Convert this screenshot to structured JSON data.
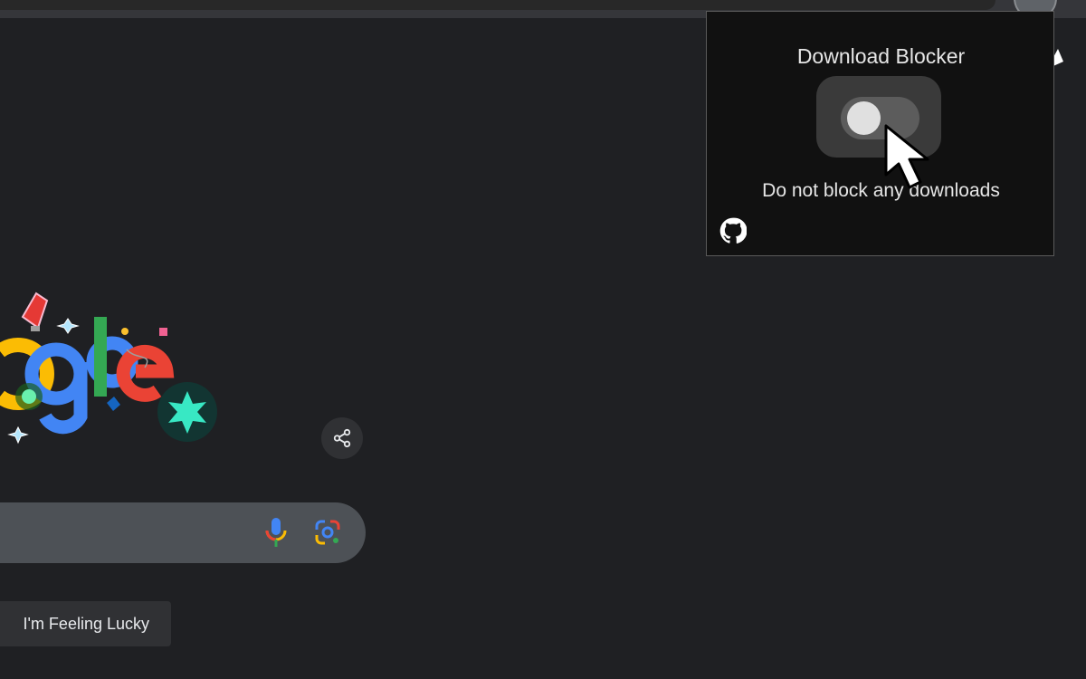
{
  "browser": {
    "ui_color": "#35363a"
  },
  "google": {
    "doodle": {
      "logo_fragment": "ogle",
      "colors": [
        "#fbbc04",
        "#4285f4",
        "#34a853",
        "#ea4335"
      ]
    },
    "share_icon": "share-icon",
    "search": {
      "mic_icon": "microphone-icon",
      "lens_icon": "google-lens-icon"
    },
    "buttons": {
      "lucky_label": "I'm Feeling Lucky"
    }
  },
  "extension_popup": {
    "title": "Download Blocker",
    "toggle_state": "off",
    "status_text": "Do not block any downloads",
    "footer_icon": "github-icon"
  }
}
